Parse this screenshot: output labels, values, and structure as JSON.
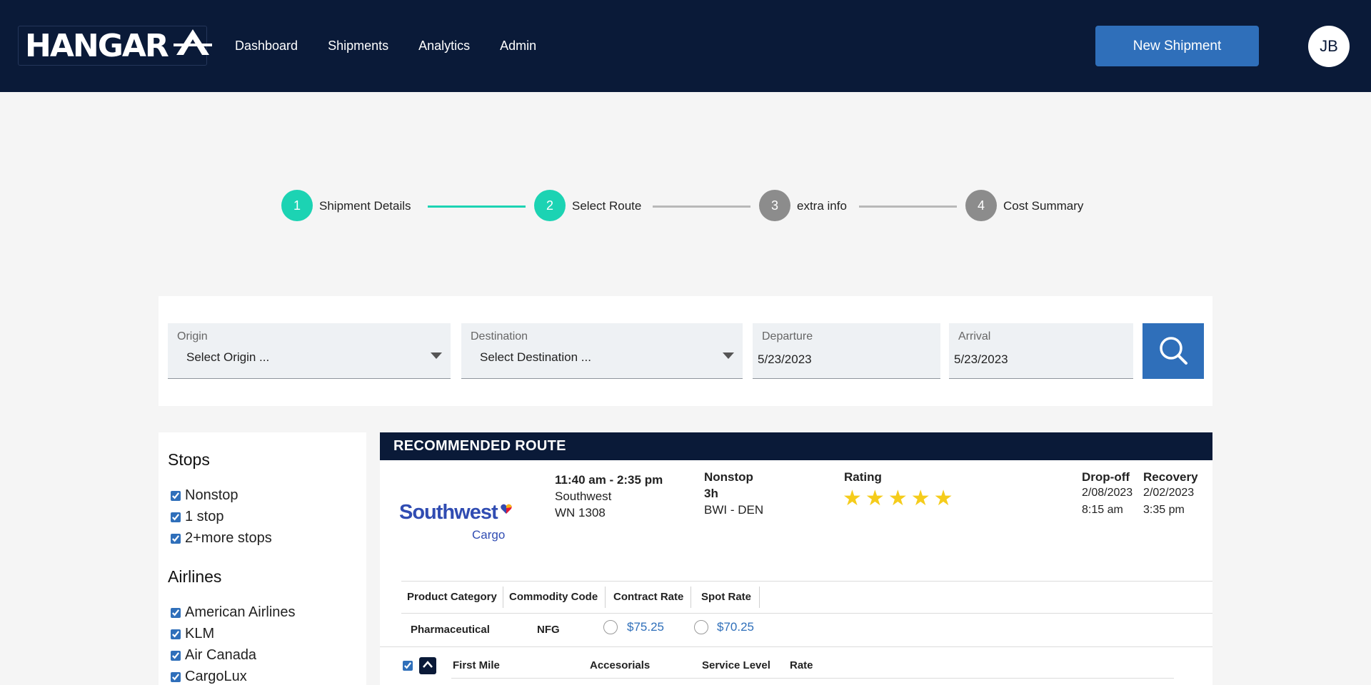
{
  "header": {
    "logo_text": "HANGAR",
    "nav": [
      "Dashboard",
      "Shipments",
      "Analytics",
      "Admin"
    ],
    "new_shipment_label": "New Shipment",
    "avatar_initials": "JB",
    "colors": {
      "navbar": "#0a1a38",
      "primary": "#2f6fba"
    }
  },
  "stepper": {
    "steps": [
      {
        "number": "1",
        "label": "Shipment Details",
        "state": "complete"
      },
      {
        "number": "2",
        "label": "Select Route",
        "state": "active"
      },
      {
        "number": "3",
        "label": "extra info",
        "state": "pending"
      },
      {
        "number": "4",
        "label": "Cost Summary",
        "state": "pending"
      }
    ],
    "colors": {
      "active": "#1cd3b3",
      "pending": "#8c8c8c"
    }
  },
  "search": {
    "origin": {
      "label": "Origin",
      "value": "Select Origin ..."
    },
    "destination": {
      "label": "Destination",
      "value": "Select Destination ..."
    },
    "departure": {
      "label": "Departure",
      "value": "5/23/2023"
    },
    "arrival": {
      "label": "Arrival",
      "value": "5/23/2023"
    },
    "search_icon": "search-icon"
  },
  "filters": {
    "stops": {
      "title": "Stops",
      "options": [
        {
          "label": "Nonstop",
          "checked": true
        },
        {
          "label": "1 stop",
          "checked": true
        },
        {
          "label": "2+more stops",
          "checked": true
        }
      ]
    },
    "airlines": {
      "title": "Airlines",
      "options": [
        {
          "label": "American Airlines",
          "checked": true
        },
        {
          "label": "KLM",
          "checked": true
        },
        {
          "label": "Air Canada",
          "checked": true
        },
        {
          "label": "CargoLux",
          "checked": true
        }
      ]
    }
  },
  "route": {
    "heading": "RECOMMENDED ROUTE",
    "airline_logo_word": "Southwest",
    "airline_logo_sub": "Cargo",
    "time_range": "11:40 am - 2:35 pm",
    "carrier": "Southwest",
    "flight": "WN 1308",
    "stops": "Nonstop",
    "duration": "3h",
    "route": "BWI - DEN",
    "rating_label": "Rating",
    "rating": 5,
    "dropoff_label": "Drop-off",
    "dropoff_date": "2/08/2023",
    "dropoff_time": "8:15 am",
    "recovery_label": "Recovery",
    "recovery_date": "2/02/2023",
    "recovery_time": "3:35 pm",
    "rates_table": {
      "headers": [
        "Product Category",
        "Commodity Code",
        "Contract Rate",
        "Spot Rate"
      ],
      "row": {
        "product_category": "Pharmaceutical",
        "commodity_code": "NFG",
        "contract_rate": "$75.25",
        "spot_rate": "$70.25"
      }
    },
    "first_mile": {
      "checked": true,
      "headers": [
        "First Mile",
        "Accesorials",
        "Service Level",
        "Rate"
      ]
    }
  }
}
